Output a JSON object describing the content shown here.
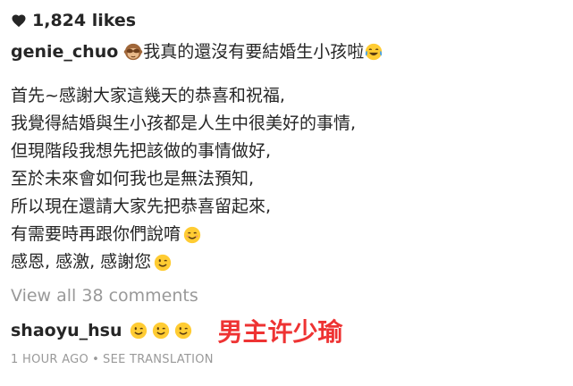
{
  "post": {
    "likes": "1,824 likes",
    "author": "genie_chuo",
    "caption_head": "我真的還沒有要結婚生小孩啦",
    "caption_lines": [
      "首先~感謝大家這幾天的恭喜和祝福,",
      "我覺得結婚與生小孩都是人生中很美好的事情,",
      "但現階段我想先把該做的事情做好,",
      "至於未來會如何我也是無法預知,",
      "所以現在還請大家先把恭喜留起來,",
      "有需要時再跟你們說唷",
      "感恩, 感激, 感謝您"
    ],
    "view_all_comments": "View all 38 comments"
  },
  "comment": {
    "author": "shaoyu_hsu",
    "annotation": "男主许少瑜"
  },
  "meta": {
    "time": "1 HOUR AGO",
    "separator": "•",
    "see_translation": "SEE TRANSLATION"
  },
  "icons": {
    "likes": "heart-icon",
    "caption_head_start": "see-no-evil-monkey-emoji",
    "caption_head_end": "tears-of-joy-emoji",
    "line6_end": "smiling-face-emoji",
    "line7_end": "winking-face-emoji",
    "comment": [
      "winking-face-emoji",
      "winking-face-emoji",
      "winking-face-emoji"
    ]
  },
  "colors": {
    "text": "#262626",
    "muted": "#999999",
    "annotation": "#ee3333",
    "emoji_yellow": "#ffcc33"
  }
}
